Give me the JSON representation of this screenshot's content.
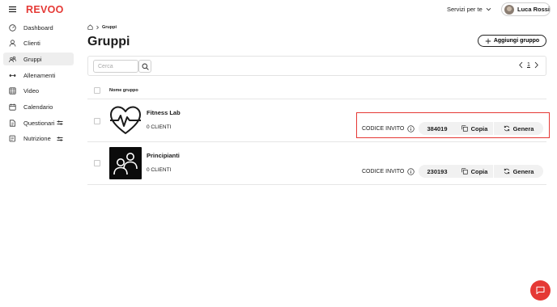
{
  "app": {
    "logo": "REVOO",
    "brand_color": "#e53935"
  },
  "header": {
    "services_label": "Servizi per te",
    "user_name": "Luca Rossi"
  },
  "sidebar": {
    "items": [
      {
        "label": "Dashboard",
        "icon": "dashboard-icon",
        "active": false
      },
      {
        "label": "Clienti",
        "icon": "user-icon",
        "active": false
      },
      {
        "label": "Gruppi",
        "icon": "group-icon",
        "active": true
      },
      {
        "label": "Allenamenti",
        "icon": "dumbbell-icon",
        "active": false
      },
      {
        "label": "Video",
        "icon": "video-icon",
        "active": false
      },
      {
        "label": "Calendario",
        "icon": "calendar-icon",
        "active": false
      },
      {
        "label": "Questionari",
        "icon": "document-icon",
        "active": false,
        "badge_icon": "switch-icon"
      },
      {
        "label": "Nutrizione",
        "icon": "nutrition-icon",
        "active": false,
        "badge_icon": "switch-icon"
      }
    ]
  },
  "breadcrumb": {
    "home_icon": "home-icon",
    "current": "Gruppi"
  },
  "page": {
    "title": "Gruppi",
    "add_button_label": "Aggiungi gruppo"
  },
  "search": {
    "placeholder": "Cerca"
  },
  "pagination": {
    "current_page": "1"
  },
  "table": {
    "header": {
      "name": "Nome gruppo"
    },
    "rows": [
      {
        "name": "Fitness Lab",
        "clients": "0 CLIENTI",
        "code_label": "CODICE INVITO",
        "code": "384019",
        "copy_label": "Copia",
        "generate_label": "Genera",
        "thumb_icon": "heart-pulse-icon"
      },
      {
        "name": "Principianti",
        "clients": "0 CLIENTI",
        "code_label": "CODICE INVITO",
        "code": "230193",
        "copy_label": "Copia",
        "generate_label": "Genera",
        "thumb_icon": "people-icon"
      }
    ]
  }
}
